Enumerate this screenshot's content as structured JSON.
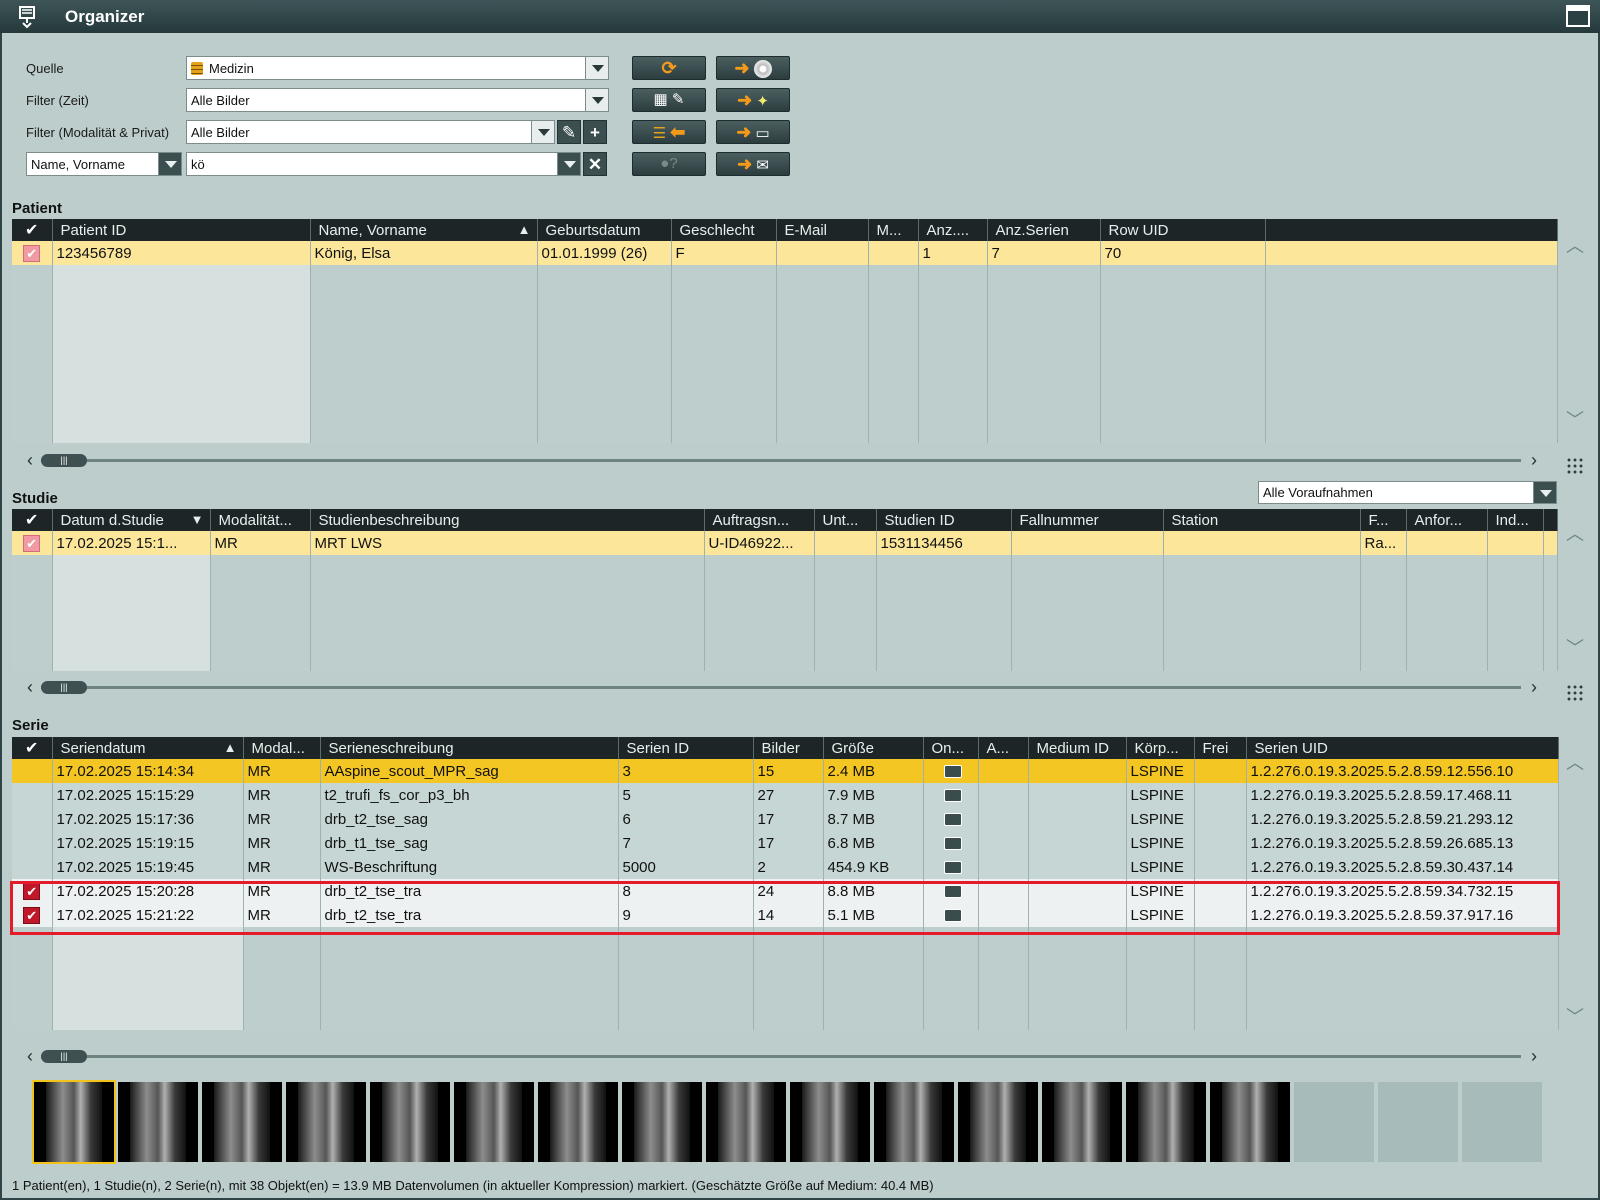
{
  "window": {
    "title": "Organizer"
  },
  "form": {
    "quelle_label": "Quelle",
    "quelle_value": "Medizin",
    "filter_zeit_label": "Filter (Zeit)",
    "filter_zeit_value": "Alle Bilder",
    "filter_mod_label": "Filter (Modalität & Privat)",
    "filter_mod_value": "Alle Bilder",
    "search_field_select": "Name, Vorname",
    "search_value": "kö"
  },
  "patient": {
    "section_title": "Patient",
    "columns": [
      "Patient ID",
      "Name, Vorname",
      "Geburtsdatum",
      "Geschlecht",
      "E-Mail",
      "M...",
      "Anz....",
      "Anz.Serien",
      "Row UID"
    ],
    "rows": [
      [
        "123456789",
        "König, Elsa",
        "01.01.1999 (26)",
        "F",
        "",
        "",
        "1",
        "7",
        "70"
      ]
    ]
  },
  "studie": {
    "section_title": "Studie",
    "prior_filter": "Alle Voraufnahmen",
    "columns": [
      "Datum d.Studie",
      "Modalität...",
      "Studienbeschreibung",
      "Auftragsn...",
      "Unt...",
      "Studien ID",
      "Fallnummer",
      "Station",
      "F...",
      "Anfor...",
      "Ind..."
    ],
    "rows": [
      [
        "17.02.2025 15:1...",
        "MR",
        "MRT LWS",
        "U-ID46922...",
        "",
        "1531134456",
        "",
        "",
        "Ra...",
        "",
        ""
      ]
    ]
  },
  "serie": {
    "section_title": "Serie",
    "columns": [
      "Seriendatum",
      "Modal...",
      "Serieneschreibung",
      "Serien ID",
      "Bilder",
      "Größe",
      "On...",
      "A...",
      "Medium ID",
      "Körp...",
      "Frei",
      "Serien UID"
    ],
    "rows": [
      {
        "checked": false,
        "cells": [
          "17.02.2025 15:14:34",
          "MR",
          "AAspine_scout_MPR_sag",
          "3",
          "15",
          "2.4 MB",
          "",
          "",
          "",
          "LSPINE",
          "",
          "1.2.276.0.19.3.2025.5.2.8.59.12.556.10"
        ]
      },
      {
        "checked": false,
        "cells": [
          "17.02.2025 15:15:29",
          "MR",
          "t2_trufi_fs_cor_p3_bh",
          "5",
          "27",
          "7.9 MB",
          "",
          "",
          "",
          "LSPINE",
          "",
          "1.2.276.0.19.3.2025.5.2.8.59.17.468.11"
        ]
      },
      {
        "checked": false,
        "cells": [
          "17.02.2025 15:17:36",
          "MR",
          "drb_t2_tse_sag",
          "6",
          "17",
          "8.7 MB",
          "",
          "",
          "",
          "LSPINE",
          "",
          "1.2.276.0.19.3.2025.5.2.8.59.21.293.12"
        ]
      },
      {
        "checked": false,
        "cells": [
          "17.02.2025 15:19:15",
          "MR",
          "drb_t1_tse_sag",
          "7",
          "17",
          "6.8 MB",
          "",
          "",
          "",
          "LSPINE",
          "",
          "1.2.276.0.19.3.2025.5.2.8.59.26.685.13"
        ]
      },
      {
        "checked": false,
        "cells": [
          "17.02.2025 15:19:45",
          "MR",
          "WS-Beschriftung",
          "5000",
          "2",
          "454.9 KB",
          "",
          "",
          "",
          "LSPINE",
          "",
          "1.2.276.0.19.3.2025.5.2.8.59.30.437.14"
        ]
      },
      {
        "checked": true,
        "cells": [
          "17.02.2025 15:20:28",
          "MR",
          "drb_t2_tse_tra",
          "8",
          "24",
          "8.8 MB",
          "",
          "",
          "",
          "LSPINE",
          "",
          "1.2.276.0.19.3.2025.5.2.8.59.34.732.15"
        ]
      },
      {
        "checked": true,
        "cells": [
          "17.02.2025 15:21:22",
          "MR",
          "drb_t2_tse_tra",
          "9",
          "14",
          "5.1 MB",
          "",
          "",
          "",
          "LSPINE",
          "",
          "1.2.276.0.19.3.2025.5.2.8.59.37.917.16"
        ]
      }
    ]
  },
  "thumbnails": {
    "filled": 15,
    "empty": 3
  },
  "status": "1 Patient(en), 1 Studie(n), 2 Serie(n), mit 38 Objekt(en) = 13.9 MB Datenvolumen (in aktueller Kompression) markiert. (Geschätzte Größe auf Medium: 40.4 MB)",
  "colors": {
    "selected_row": "#fbe69a",
    "highlight_row": "#f4c623",
    "checkbox": "#c0182a",
    "marker": "#e31b2b",
    "header": "#1d2526"
  }
}
